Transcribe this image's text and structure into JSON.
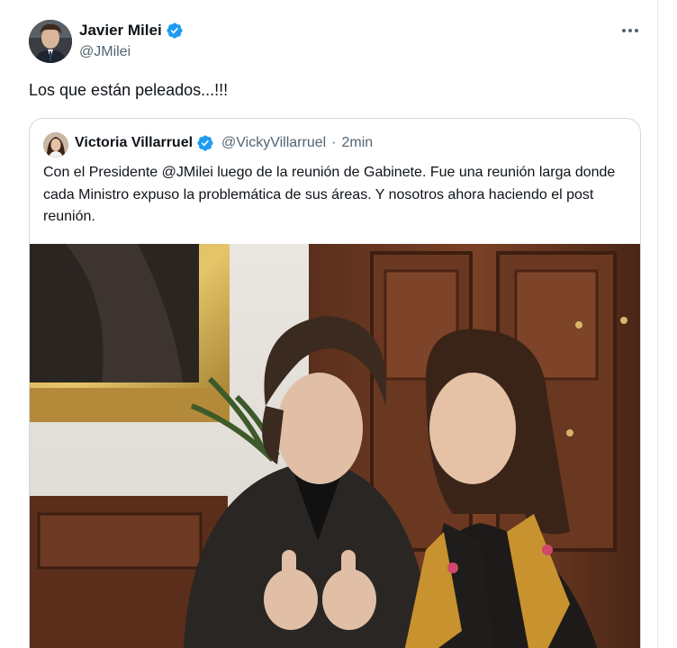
{
  "tweet": {
    "author_name": "Javier Milei",
    "author_handle": "@JMilei",
    "text": "Los que están peleados...!!!",
    "verified_icon": "verified-badge-icon",
    "more_icon": "more-options-icon"
  },
  "quoted_tweet": {
    "author_name": "Victoria Villarruel",
    "author_handle": "@VickyVillarruel",
    "separator": "·",
    "time": "2min",
    "text": "Con el Presidente @JMilei luego de la reunión de Gabinete. Fue una reunión larga donde cada Ministro expuso la problemática de sus áreas. Y nosotros ahora haciendo el post reunión.",
    "verified_icon": "verified-badge-icon"
  },
  "colors": {
    "text_primary": "#0f1419",
    "text_secondary": "#536471",
    "verified_blue": "#1d9bf0",
    "border": "#cfd9de"
  }
}
